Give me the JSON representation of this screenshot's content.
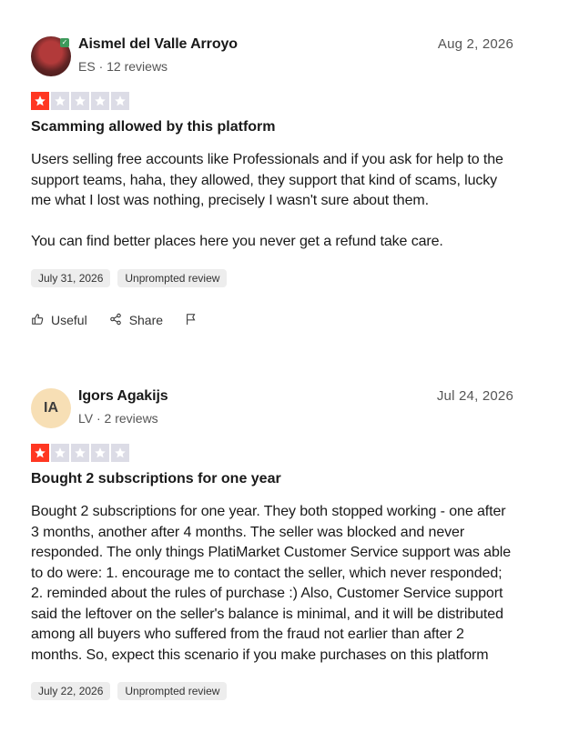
{
  "reviews": [
    {
      "reviewer_name": "Aismel del Valle Arroyo",
      "country": "ES",
      "review_count": "12 reviews",
      "date": "Aug 2, 2026",
      "rating": 1,
      "avatar_type": "photo",
      "title": "Scamming allowed by this platform",
      "body": "Users selling free accounts like Professionals and if you ask for help to the support teams, haha, they allowed, they support that kind of scams, lucky me what I lost was nothing, precisely I wasn't sure about them.\n\nYou can find better places here you never get a refund take care.",
      "experience_date": "July 31, 2026",
      "tag": "Unprompted review",
      "actions": {
        "useful": "Useful",
        "share": "Share"
      }
    },
    {
      "reviewer_name": "Igors Agakijs",
      "avatar_initials": "IA",
      "country": "LV",
      "review_count": "2 reviews",
      "date": "Jul 24, 2026",
      "rating": 1,
      "avatar_type": "initials",
      "title": "Bought 2 subscriptions for one year",
      "body": "Bought 2 subscriptions for one year. They both stopped working - one after 3 months, another after 4 months. The seller was blocked and never responded. The only things PlatiMarket Customer Service support was able to do were: 1. encourage me to contact the seller, which never responded; 2. reminded about the rules of purchase :) Also, Customer Service support said the leftover on the seller's balance is minimal, and it will be distributed among all buyers who suffered from the fraud not earlier than after 2 months. So, expect this scenario if you make purchases on this platform",
      "experience_date": "July 22, 2026",
      "tag": "Unprompted review"
    }
  ],
  "colors": {
    "star_on": "#ff3722",
    "star_off": "#dcdce6",
    "verified": "#3d9a5b"
  },
  "icons": [
    "thumbs-up-icon",
    "share-icon",
    "flag-icon",
    "star-icon",
    "verified-check-icon"
  ]
}
